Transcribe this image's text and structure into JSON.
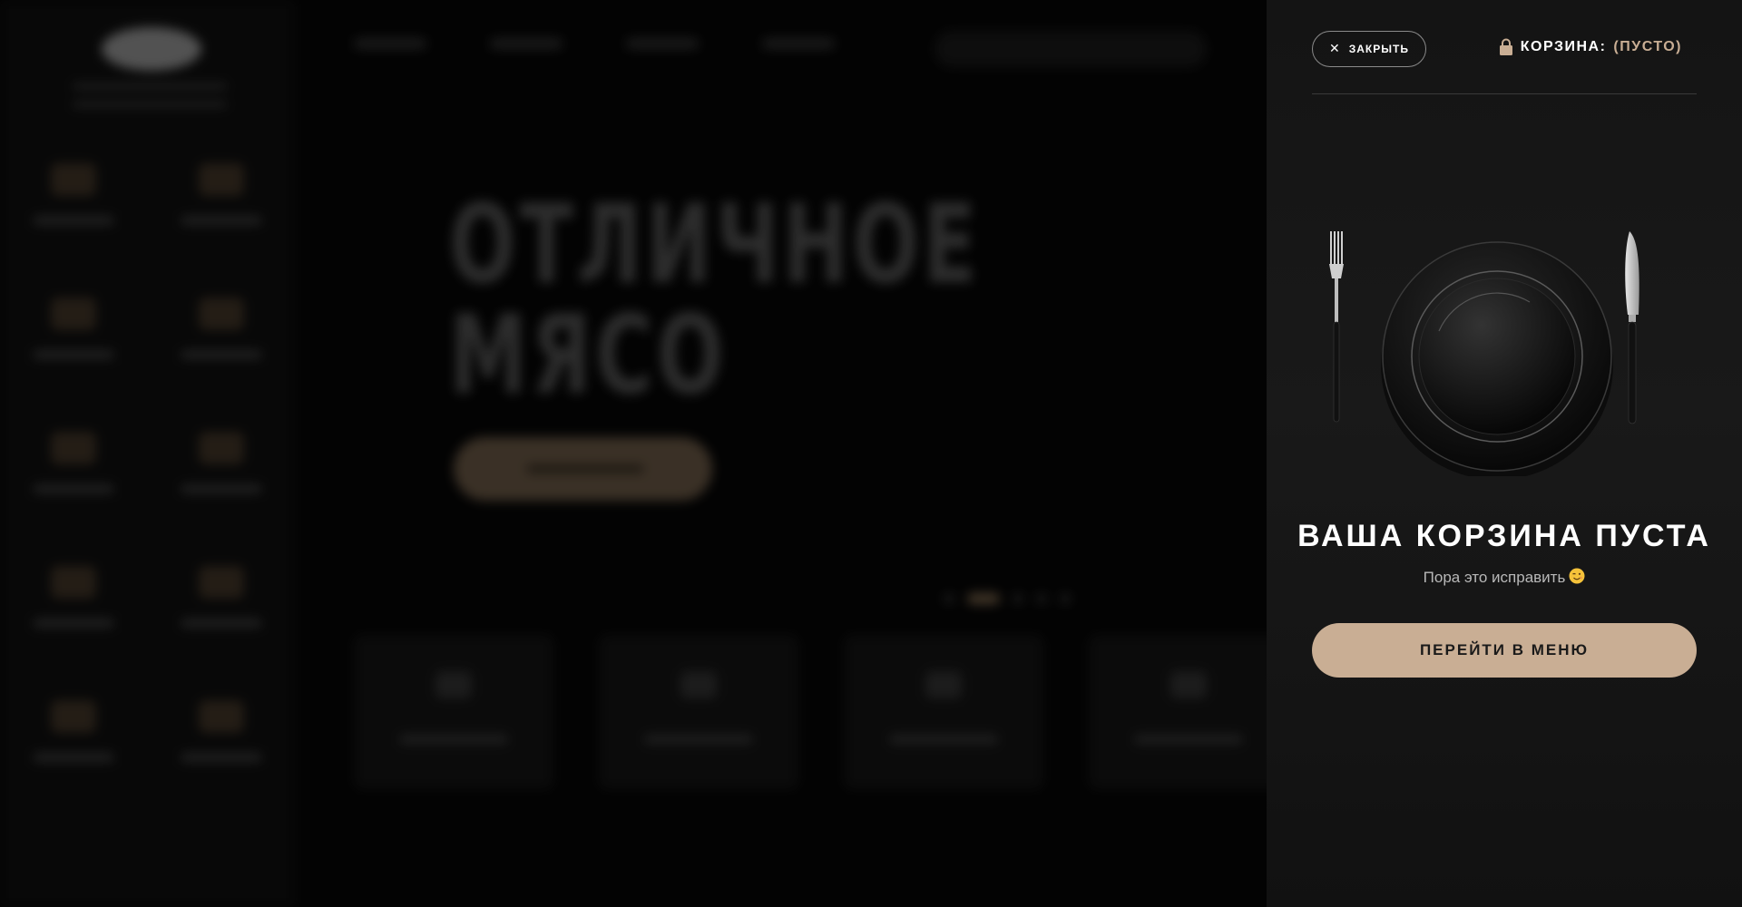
{
  "background": {
    "hero_title_line1": "ОТЛИЧНОЕ",
    "hero_title_line2": "МЯСО"
  },
  "drawer": {
    "close_label": "ЗАКРЫТЬ",
    "cart_label": "КОРЗИНА:",
    "cart_status": "(ПУСТО)",
    "empty_title": "ВАША КОРЗИНА ПУСТА",
    "empty_subtitle": "Пора это исправить",
    "menu_button": "ПЕРЕЙТИ В МЕНЮ",
    "accent_color": "#c9ae94",
    "icons": [
      "close-icon",
      "lock-icon",
      "wink-emoji-icon",
      "plate-illustration"
    ]
  }
}
